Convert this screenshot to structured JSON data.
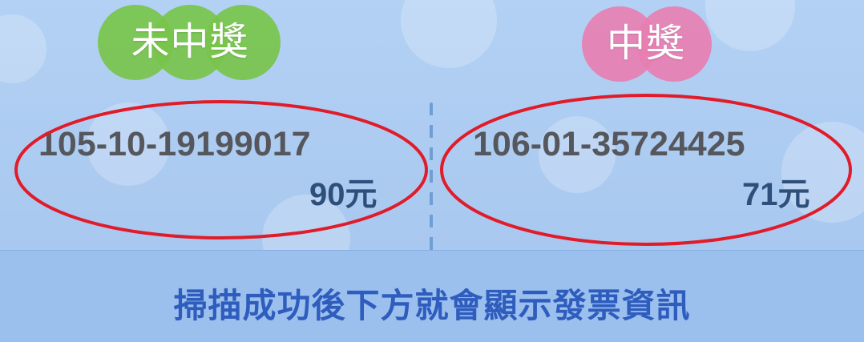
{
  "colors": {
    "background_top": "#b3d1f4",
    "background_bottom": "#9cc0ee",
    "badge_not_won": "#78c44b",
    "badge_won": "#e77fb2",
    "invoice_text": "#55575c",
    "amount_text": "#2f4f7b",
    "highlight_ellipse": "#e01c2a",
    "footer_text": "#2f5dbe"
  },
  "left_panel": {
    "badge": "未中獎",
    "invoice_number": "105-10-19199017",
    "amount": "90元"
  },
  "right_panel": {
    "badge": "中獎",
    "invoice_number": "106-01-35724425",
    "amount": "71元"
  },
  "footer": {
    "message": "掃描成功後下方就會顯示發票資訊"
  }
}
